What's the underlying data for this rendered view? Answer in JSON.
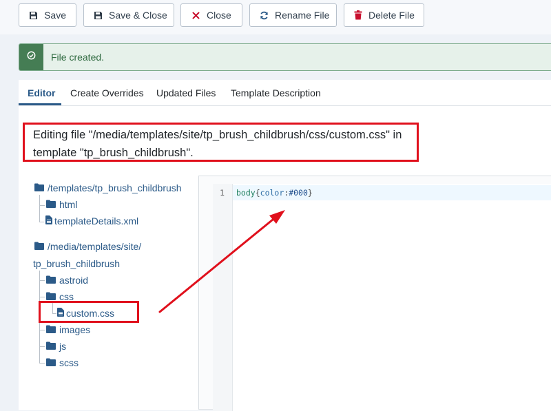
{
  "toolbar": {
    "buttons": [
      {
        "label": "Save",
        "icon": "save-icon"
      },
      {
        "label": "Save & Close",
        "icon": "save-icon"
      },
      {
        "label": "Close",
        "icon": "close-icon"
      },
      {
        "label": "Rename File",
        "icon": "refresh-icon"
      },
      {
        "label": "Delete File",
        "icon": "trash-icon"
      }
    ]
  },
  "alert": {
    "message": "File created.",
    "icon": "check-circle-icon"
  },
  "tabs": [
    {
      "label": "Editor",
      "active": true
    },
    {
      "label": "Create Overrides"
    },
    {
      "label": "Updated Files"
    },
    {
      "label": "Template Description"
    }
  ],
  "editing_note": {
    "line1": "Editing file \"/media/templates/site/tp_brush_childbrush/css/custom.css\" in",
    "line2": "template \"tp_brush_childbrush\"."
  },
  "file_tree": {
    "root1": {
      "label": "/templates/tp_brush_childbrush",
      "icon": "folder-icon"
    },
    "root1_children": [
      {
        "label": "html",
        "icon": "folder-icon"
      },
      {
        "label": "templateDetails.xml",
        "icon": "file-icon"
      }
    ],
    "root2": {
      "label_line1": "/media/templates/site/",
      "label_line2": "tp_brush_childbrush",
      "icon": "folder-icon"
    },
    "root2_children": [
      {
        "label": "astroid",
        "icon": "folder-icon"
      },
      {
        "label": "css",
        "icon": "folder-icon"
      },
      {
        "label": "custom.css",
        "icon": "file-icon"
      },
      {
        "label": "images",
        "icon": "folder-icon"
      },
      {
        "label": "js",
        "icon": "folder-icon"
      },
      {
        "label": "scss",
        "icon": "folder-icon"
      }
    ]
  },
  "editor": {
    "line_number": "1",
    "code_selector": "body",
    "code_open": "{",
    "code_property": "color",
    "code_colon": ":",
    "code_value": "#000",
    "code_close": "}"
  },
  "colors": {
    "annotation": "#e0101c",
    "accent": "#2b5a88",
    "success": "#457d54",
    "danger": "#c8102e"
  }
}
